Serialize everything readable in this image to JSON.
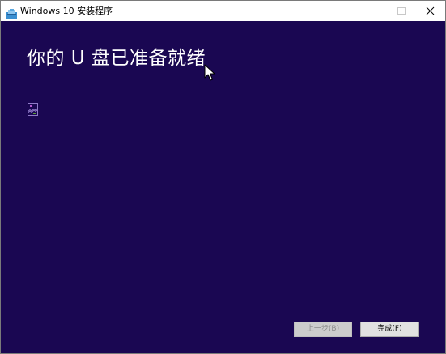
{
  "window": {
    "title": "Windows 10 安装程序"
  },
  "main": {
    "heading": "你的 U 盘已准备就绪"
  },
  "footer": {
    "back_label": "上一步(B)",
    "finish_label": "完成(F)"
  },
  "colors": {
    "content_background": "#1a0752",
    "heading_text": "#ffffff"
  },
  "icons": {
    "app": "setup-app-icon",
    "placeholder": "broken-image-icon",
    "pointer": "mouse-cursor-icon"
  }
}
